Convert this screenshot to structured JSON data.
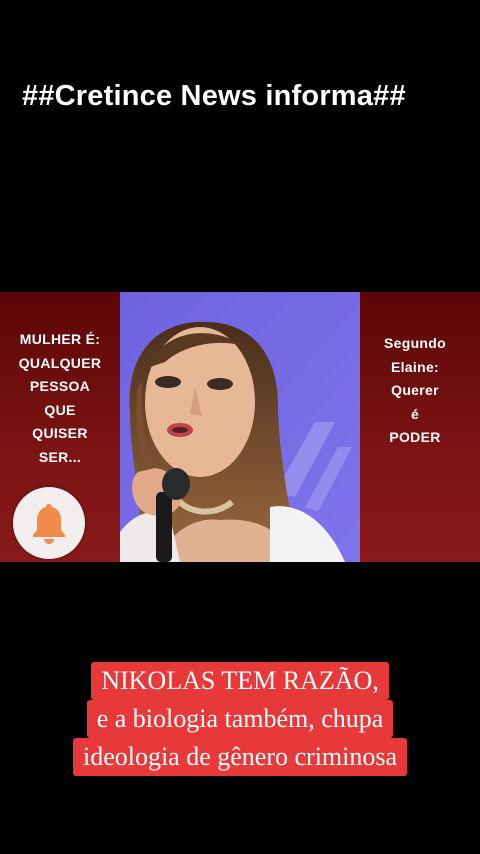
{
  "header": {
    "title": "##Cretince News informa##"
  },
  "left_panel": {
    "lines": [
      "MULHER É:",
      "QUALQUER",
      "PESSOA",
      "QUE",
      "QUISER",
      "SER..."
    ]
  },
  "right_panel": {
    "lines": [
      "Segundo",
      "Elaine:",
      "Querer",
      "é",
      "PODER"
    ]
  },
  "subscribe": {
    "icon": "bell-icon",
    "color": "#f28a4a"
  },
  "caption": {
    "lines": [
      "NIKOLAS TEM RAZÃO,",
      "e a biologia também, chupa",
      "ideologia de gênero criminosa"
    ],
    "background": "#e8393a"
  }
}
